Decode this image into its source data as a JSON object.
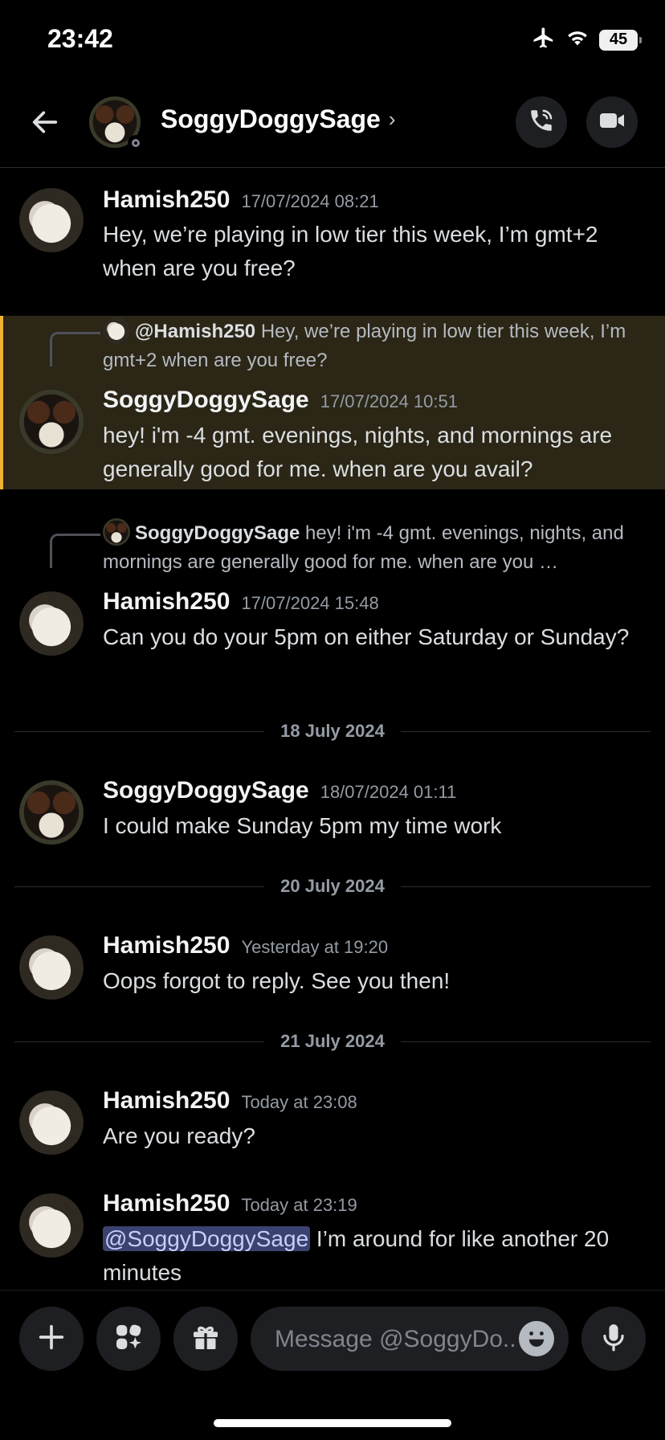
{
  "status_bar": {
    "time": "23:42",
    "battery": "45"
  },
  "header": {
    "title": "SoggyDoggySage",
    "chevron": "›"
  },
  "messages": [
    {
      "author": "Hamish250",
      "timestamp": "17/07/2024 08:21",
      "text": "Hey, we’re playing in low tier this week, I’m gmt+2 when are you free?"
    },
    {
      "reply_name": "@Hamish250",
      "reply_text": "Hey, we’re playing in low tier this week, I’m gmt+2 when are you free?",
      "author": "SoggyDoggySage",
      "timestamp": "17/07/2024 10:51",
      "text": "hey! i'm -4 gmt. evenings, nights, and mornings are generally good for me. when are you avail?"
    },
    {
      "reply_name": "SoggyDoggySage",
      "reply_text": "hey! i'm -4 gmt. evenings, nights, and mornings are generally good for me. when are you …",
      "author": "Hamish250",
      "timestamp": "17/07/2024 15:48",
      "text": "Can you do your 5pm on either Saturday or Sunday?"
    },
    {
      "author": "SoggyDoggySage",
      "timestamp": "18/07/2024 01:11",
      "text": "I could make Sunday 5pm my time work"
    },
    {
      "author": "Hamish250",
      "timestamp": "Yesterday at 19:20",
      "text": "Oops forgot to reply. See you then!"
    },
    {
      "author": "Hamish250",
      "timestamp": "Today at 23:08",
      "text": "Are you ready?"
    },
    {
      "author": "Hamish250",
      "timestamp": "Today at 23:19",
      "mention": "@SoggyDoggySage",
      "text": " I’m around for like another 20 minutes"
    }
  ],
  "date_separators": [
    "18 July 2024",
    "20 July 2024",
    "21 July 2024"
  ],
  "composer": {
    "placeholder": "Message @SoggyDo.."
  },
  "colors": {
    "background": "#000000",
    "highlight_bg": "#2b2616",
    "highlight_bar": "#f0b232",
    "mention_bg": "#3c4270"
  },
  "icons": [
    "airplane-icon",
    "wifi-icon",
    "back-arrow-icon",
    "phone-call-icon",
    "video-camera-icon",
    "plus-icon",
    "apps-icon",
    "gift-icon",
    "emoji-icon",
    "microphone-icon"
  ]
}
